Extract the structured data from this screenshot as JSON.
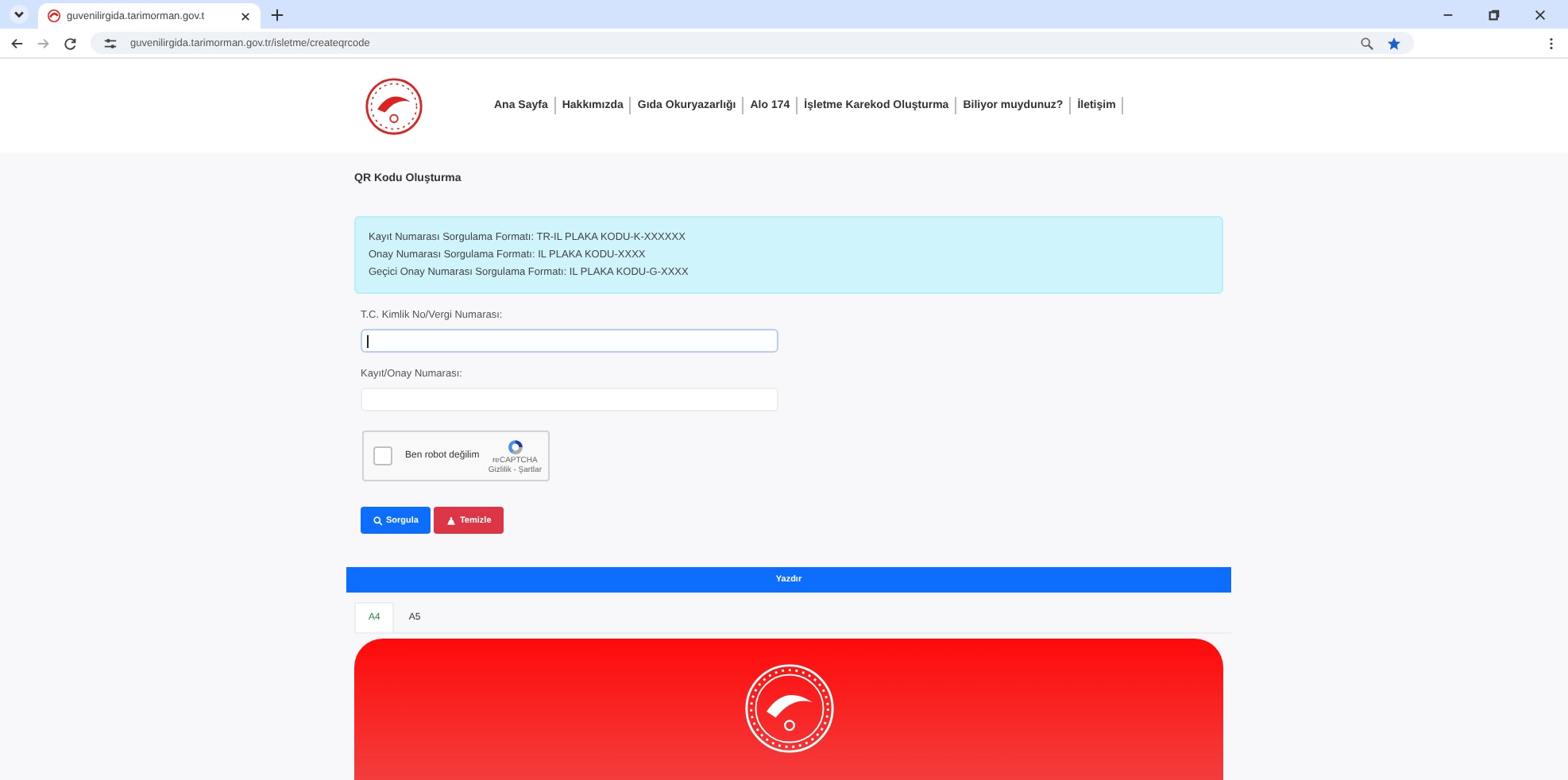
{
  "browser": {
    "tab_title": "guvenilirgida.tarimorman.gov.t",
    "url": "guvenilirgida.tarimorman.gov.tr/isletme/createqrcode"
  },
  "nav": [
    "Ana Sayfa",
    "Hakkımızda",
    "Gıda Okuryazarlığı",
    "Alo 174",
    "İşletme Karekod Oluşturma",
    "Biliyor muydunuz?",
    "İletişim"
  ],
  "page_title": "QR Kodu Oluşturma",
  "info_lines": [
    "Kayıt Numarası Sorgulama Formatı: TR-IL PLAKA KODU-K-XXXXXX",
    "Onay Numarası Sorgulama Formatı: IL PLAKA KODU-XXXX",
    "Geçici Onay Numarası Sorgulama Formatı: IL PLAKA KODU-G-XXXX"
  ],
  "fields": [
    {
      "label": "T.C. Kimlik No/Vergi Numarası:",
      "focused": true
    },
    {
      "label": "Kayıt/Onay Numarası:",
      "focused": false
    }
  ],
  "captcha": {
    "label": "Ben robot değilim",
    "checked": false,
    "brand": "reCAPTCHA",
    "terms": "Gizlilik - Şartlar"
  },
  "buttons": [
    {
      "label": "Sorgula",
      "kind": "search"
    },
    {
      "label": "Temizle",
      "kind": "clear"
    }
  ],
  "print_button": "Yazdır",
  "tabs": [
    {
      "label": "A4",
      "selected": true
    },
    {
      "label": "A5",
      "selected": false
    }
  ]
}
